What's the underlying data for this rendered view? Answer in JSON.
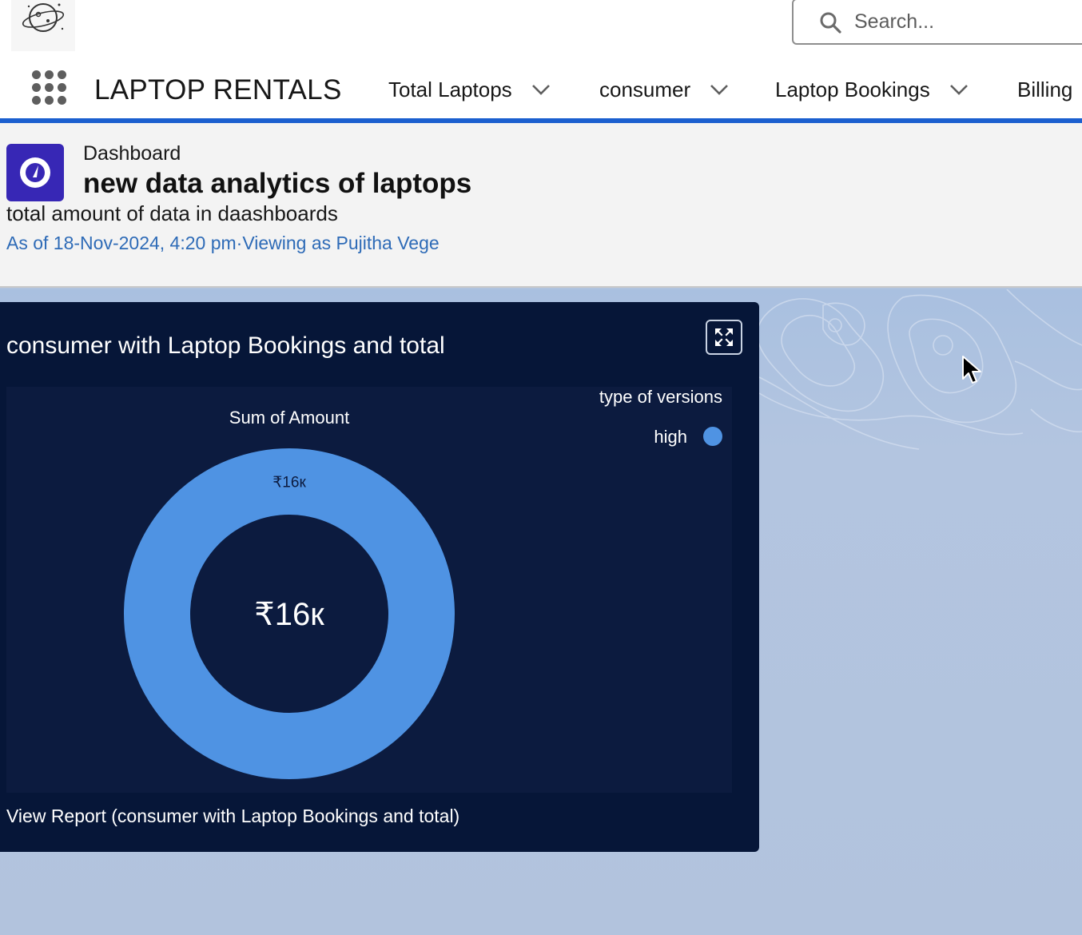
{
  "header": {
    "search_placeholder": "Search..."
  },
  "nav": {
    "app_name": "LAPTOP RENTALS",
    "items": [
      {
        "label": "Total Laptops"
      },
      {
        "label": "consumer"
      },
      {
        "label": "Laptop Bookings"
      },
      {
        "label": "Billing"
      }
    ]
  },
  "page": {
    "object_label": "Dashboard",
    "title": "new data analytics of laptops",
    "description": "total amount of data in daashboards",
    "meta": "As of 18-Nov-2024, 4:20 pm·Viewing as Pujitha Vege"
  },
  "widget": {
    "title": "consumer with Laptop Bookings and total",
    "view_report": "View Report (consumer with Laptop Bookings and total)"
  },
  "chart_data": {
    "type": "donut",
    "title": "Sum of Amount",
    "legend_title": "type of versions",
    "legend_position": "top-right",
    "center_label": "₹16к",
    "series": [
      {
        "name": "high",
        "value": 16000,
        "label": "₹16к",
        "color": "#4f93e3"
      }
    ]
  },
  "colors": {
    "accent": "#1b5fcf",
    "dashboard_icon": "#3727b5",
    "widget_bg": "#061638",
    "chart_bg": "#0c1b3f",
    "series_high": "#4f93e3",
    "meta_link": "#2e6bb7"
  },
  "icons": {
    "logo": "planet-logo-icon",
    "search": "search-icon",
    "launcher": "app-launcher-icon",
    "chevron": "chevron-down-icon",
    "dashboard": "dashboard-gauge-icon",
    "expand": "expand-icon",
    "cursor": "mouse-pointer-icon"
  }
}
